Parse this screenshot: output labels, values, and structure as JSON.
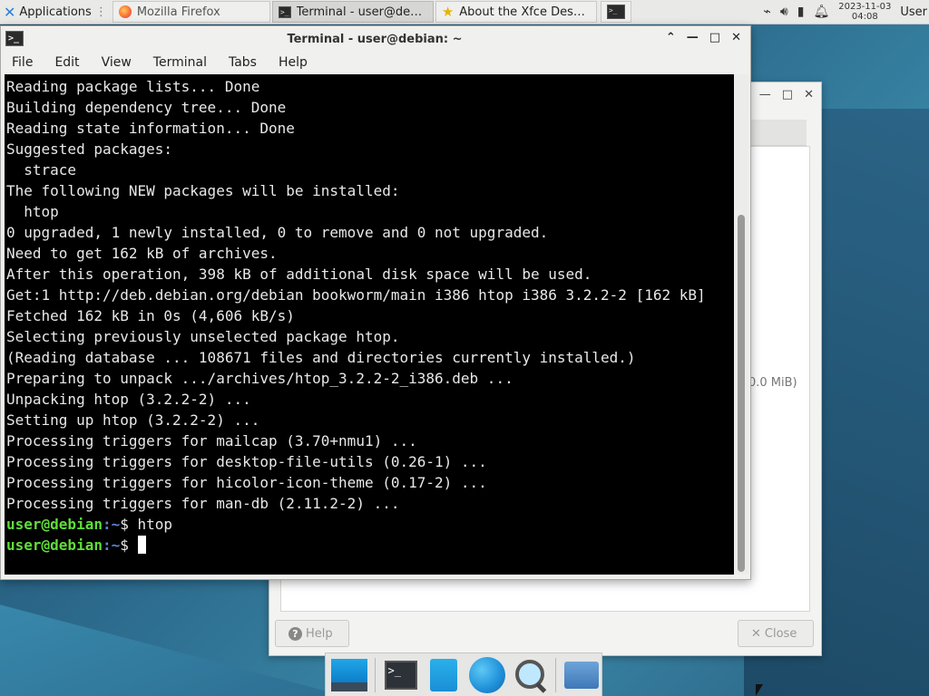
{
  "panel": {
    "applications_label": "Applications",
    "tasks": [
      {
        "label": "Mozilla Firefox",
        "icon": "firefox-icon"
      },
      {
        "label": "Terminal - user@deb...",
        "icon": "terminal-icon"
      },
      {
        "label": "About the Xfce Desk...",
        "icon": "star-icon"
      }
    ],
    "clock_date": "2023-11-03",
    "clock_time": "04:08",
    "user_label": "User"
  },
  "dialog": {
    "size_text": "0.0 MiB)",
    "help_label": "Help",
    "close_label": "Close"
  },
  "terminal": {
    "title": "Terminal - user@debian: ~",
    "menu": [
      "File",
      "Edit",
      "View",
      "Terminal",
      "Tabs",
      "Help"
    ],
    "output_lines": [
      "Reading package lists... Done",
      "Building dependency tree... Done",
      "Reading state information... Done",
      "Suggested packages:",
      "  strace",
      "The following NEW packages will be installed:",
      "  htop",
      "0 upgraded, 1 newly installed, 0 to remove and 0 not upgraded.",
      "Need to get 162 kB of archives.",
      "After this operation, 398 kB of additional disk space will be used.",
      "Get:1 http://deb.debian.org/debian bookworm/main i386 htop i386 3.2.2-2 [162 kB]",
      "Fetched 162 kB in 0s (4,606 kB/s)",
      "Selecting previously unselected package htop.",
      "(Reading database ... 108671 files and directories currently installed.)",
      "Preparing to unpack .../archives/htop_3.2.2-2_i386.deb ...",
      "Unpacking htop (3.2.2-2) ...",
      "Setting up htop (3.2.2-2) ...",
      "Processing triggers for mailcap (3.70+nmu1) ...",
      "Processing triggers for desktop-file-utils (0.26-1) ...",
      "Processing triggers for hicolor-icon-theme (0.17-2) ...",
      "Processing triggers for man-db (2.11.2-2) ..."
    ],
    "prompt_user": "user@debian",
    "prompt_path": ":~",
    "prompt_symbol": "$",
    "last_command": " htop",
    "current_input": " "
  },
  "dock": {
    "items": [
      "desktop-icon",
      "terminal-icon",
      "file-icon",
      "globe-icon",
      "search-icon",
      "folder-icon"
    ]
  },
  "colors": {
    "prompt_user": "#5fdd3a",
    "prompt_path": "#5b84d6",
    "terminal_bg": "#000000",
    "terminal_fg": "#e8e8e8"
  }
}
